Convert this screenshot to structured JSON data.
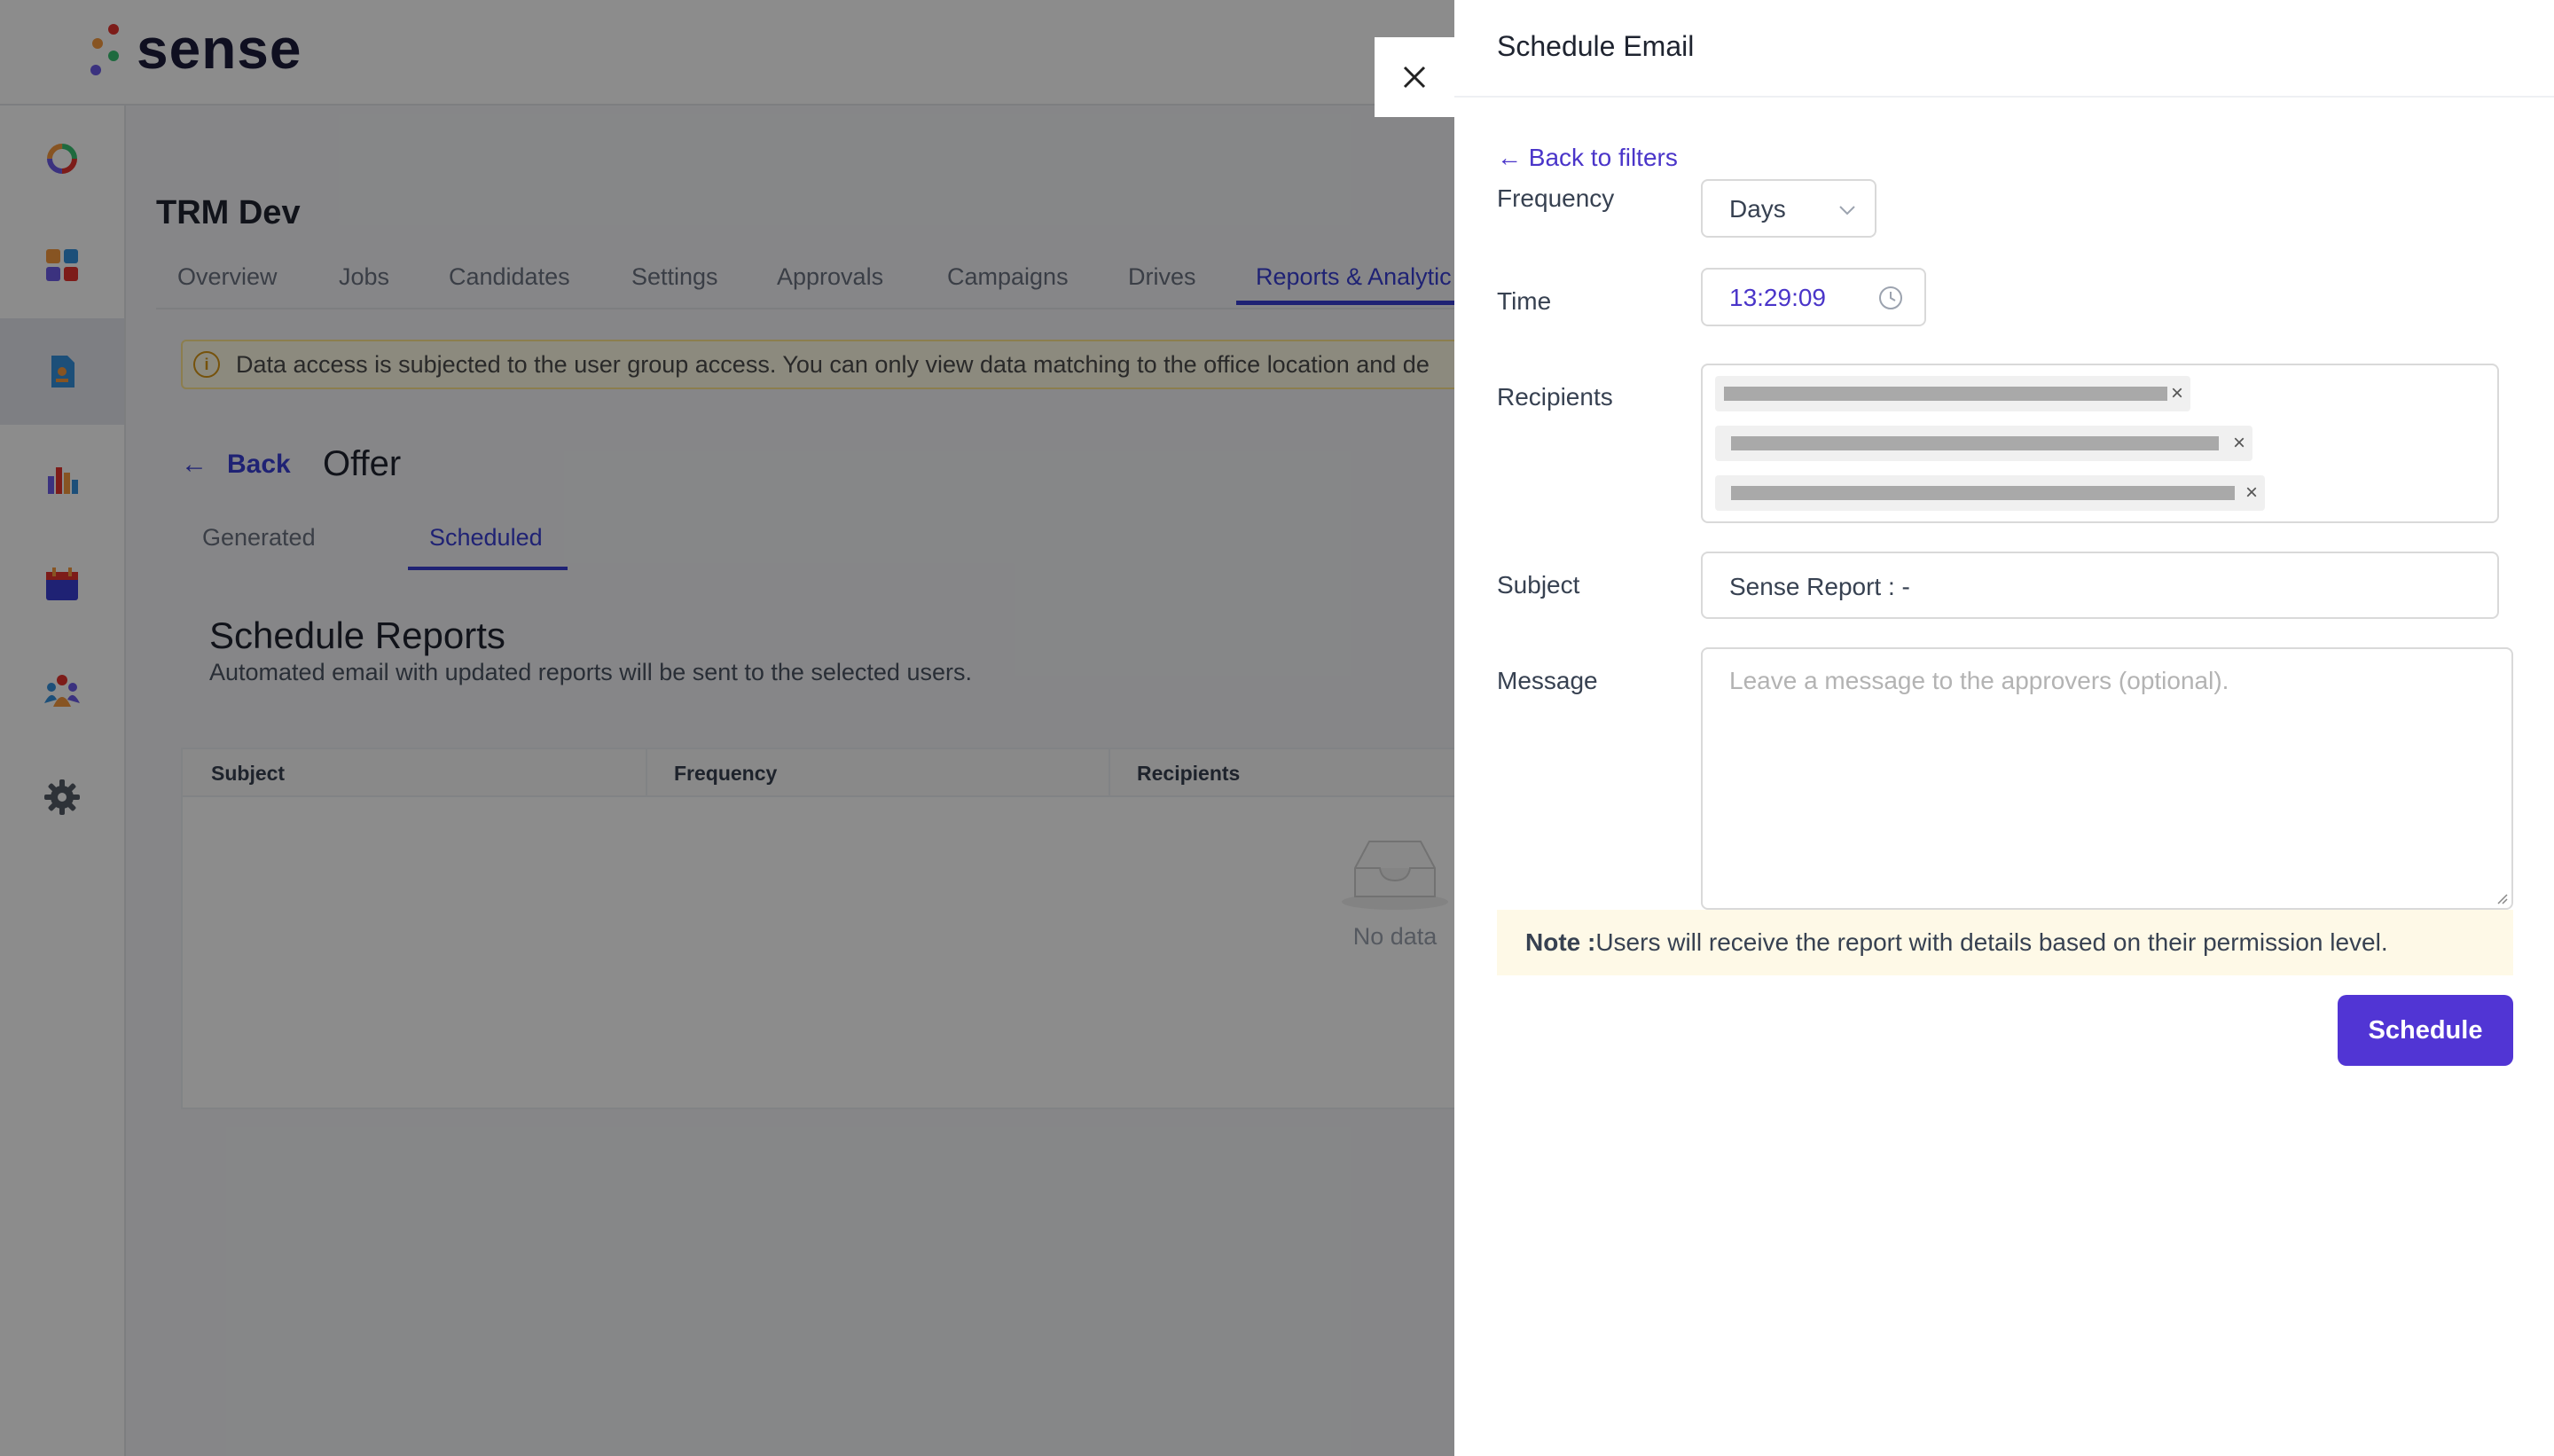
{
  "app": {
    "brand": "sense",
    "project_title": "TRM Dev",
    "tabs": [
      {
        "label": "Overview"
      },
      {
        "label": "Jobs"
      },
      {
        "label": "Candidates"
      },
      {
        "label": "Settings"
      },
      {
        "label": "Approvals"
      },
      {
        "label": "Campaigns"
      },
      {
        "label": "Drives"
      },
      {
        "label": "Reports & Analytic"
      }
    ],
    "alert_text": "Data access is subjected to the user group access. You can only view data matching to the office location and de",
    "back_label": "Back",
    "page_title": "Offer",
    "sub_tabs": [
      {
        "label": "Generated"
      },
      {
        "label": "Scheduled"
      }
    ],
    "schedule_title": "Schedule Reports",
    "schedule_desc": "Automated email with updated reports will be sent to the selected users.",
    "table_headers": [
      "Subject",
      "Frequency",
      "Recipients"
    ],
    "empty_text": "No data",
    "sidebar_icons": [
      "ring-icon",
      "grid-icon",
      "report-icon",
      "bar-chart-icon",
      "calendar-icon",
      "team-icon",
      "settings-icon"
    ]
  },
  "drawer": {
    "title": "Schedule Email",
    "back_to_filters": "← Back to filters",
    "frequency": {
      "label": "Frequency",
      "value": "Days"
    },
    "time": {
      "label": "Time",
      "value": "13:29:09"
    },
    "recipients": {
      "label": "Recipients"
    },
    "subject": {
      "label": "Subject",
      "value": "Sense Report : -"
    },
    "message": {
      "label": "Message",
      "placeholder": "Leave a message to the approvers (optional)."
    },
    "note": {
      "label": "Note :",
      "text": "Users will receive the report with details based on their permission level."
    },
    "schedule_button": "Schedule",
    "close_icon": "close-icon"
  },
  "colors": {
    "accent": "#5135d4",
    "link": "#4a35c9",
    "tab_active": "#3a3fd4",
    "overlay": "rgba(0,0,0,0.45)",
    "note_bg": "#fef9e7"
  }
}
